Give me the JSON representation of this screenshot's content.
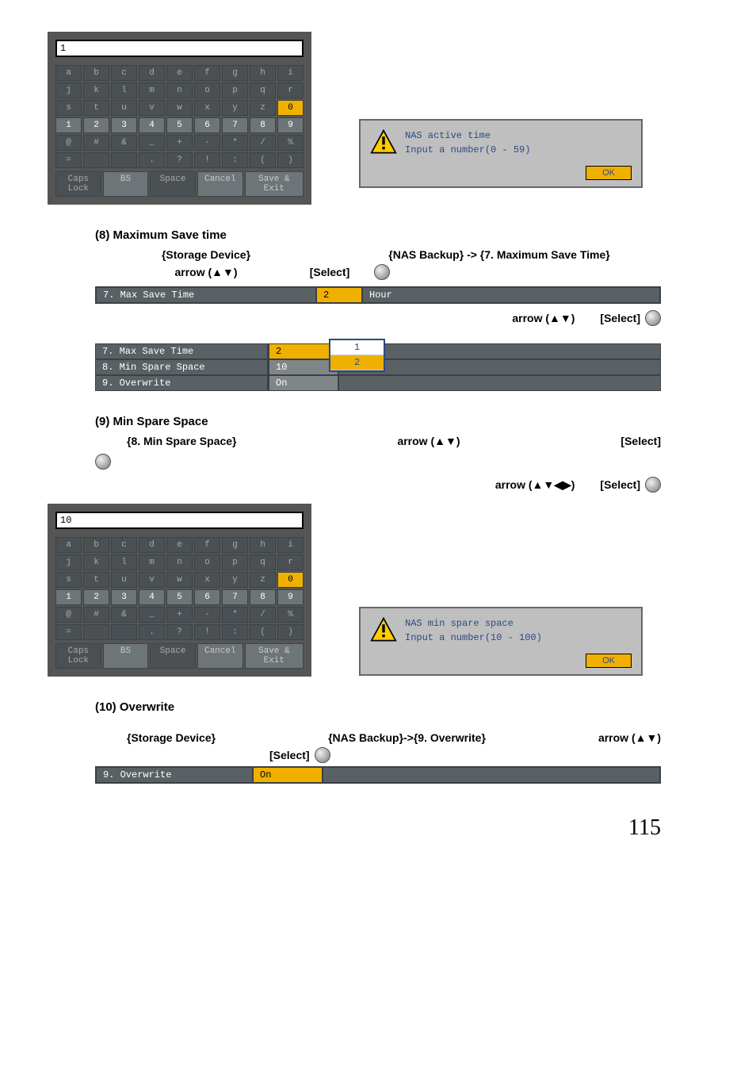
{
  "keyboard1": {
    "display": "1",
    "rows": [
      [
        "a",
        "b",
        "c",
        "d",
        "e",
        "f",
        "g",
        "h",
        "i"
      ],
      [
        "j",
        "k",
        "l",
        "m",
        "n",
        "o",
        "p",
        "q",
        "r"
      ],
      [
        "s",
        "t",
        "u",
        "v",
        "w",
        "x",
        "y",
        "z",
        "0"
      ],
      [
        "1",
        "2",
        "3",
        "4",
        "5",
        "6",
        "7",
        "8",
        "9"
      ],
      [
        "@",
        "#",
        "&",
        "_",
        "+",
        "-",
        "*",
        "/",
        "%"
      ],
      [
        "=",
        "",
        "",
        ".",
        "?",
        "!",
        ":",
        "(",
        ")"
      ]
    ],
    "bottom": [
      "Caps Lock",
      "BS",
      "Space",
      "Cancel",
      "Save & Exit"
    ]
  },
  "keyboard2": {
    "display": "10",
    "rows": [
      [
        "a",
        "b",
        "c",
        "d",
        "e",
        "f",
        "g",
        "h",
        "i"
      ],
      [
        "j",
        "k",
        "l",
        "m",
        "n",
        "o",
        "p",
        "q",
        "r"
      ],
      [
        "s",
        "t",
        "u",
        "v",
        "w",
        "x",
        "y",
        "z",
        "0"
      ],
      [
        "1",
        "2",
        "3",
        "4",
        "5",
        "6",
        "7",
        "8",
        "9"
      ],
      [
        "@",
        "#",
        "&",
        "_",
        "+",
        "-",
        "*",
        "/",
        "%"
      ],
      [
        "=",
        "",
        "",
        ".",
        "?",
        "!",
        ":",
        "(",
        ")"
      ]
    ],
    "bottom": [
      "Caps Lock",
      "BS",
      "Space",
      "Cancel",
      "Save & Exit"
    ]
  },
  "dialog1": {
    "line1": "NAS active time",
    "line2": "Input a number(0 - 59)",
    "ok": "OK"
  },
  "dialog2": {
    "line1": "NAS min spare space",
    "line2": "Input a number(10 - 100)",
    "ok": "OK"
  },
  "sections": {
    "s8": {
      "heading": "(8) Maximum Save time",
      "nav1_left": "{Storage Device}",
      "nav1_right": "{NAS Backup} -> {7. Maximum Save Time}",
      "nav2_left": "arrow (▲▼)",
      "nav2_right": "[Select]",
      "bar_label": "7. Max Save Time",
      "bar_value": "2",
      "bar_unit": "Hour",
      "nav3_arrow": "arrow (▲▼)",
      "nav3_select": "[Select]",
      "rows": [
        {
          "label": "7. Max Save Time",
          "val": "2",
          "cls": "yellow"
        },
        {
          "label": "8. Min Spare Space",
          "val": "10",
          "cls": "gray"
        },
        {
          "label": "9. Overwrite",
          "val": "On",
          "cls": "gray"
        }
      ],
      "dropdown": [
        "1",
        "2"
      ]
    },
    "s9": {
      "heading": "(9) Min Spare Space",
      "nav_a": "{8. Min Spare Space}",
      "nav_b": "arrow (▲▼)",
      "nav_c": "[Select]",
      "nav2_a": "arrow (▲▼◀▶)",
      "nav2_b": "[Select]"
    },
    "s10": {
      "heading": "(10) Overwrite",
      "nav_a": "{Storage Device}",
      "nav_b": "{NAS Backup}->{9. Overwrite}",
      "nav_c": "arrow (▲▼)",
      "nav_d": "[Select]",
      "bar_label": "9. Overwrite",
      "bar_value": "On"
    }
  },
  "page_number": "115"
}
